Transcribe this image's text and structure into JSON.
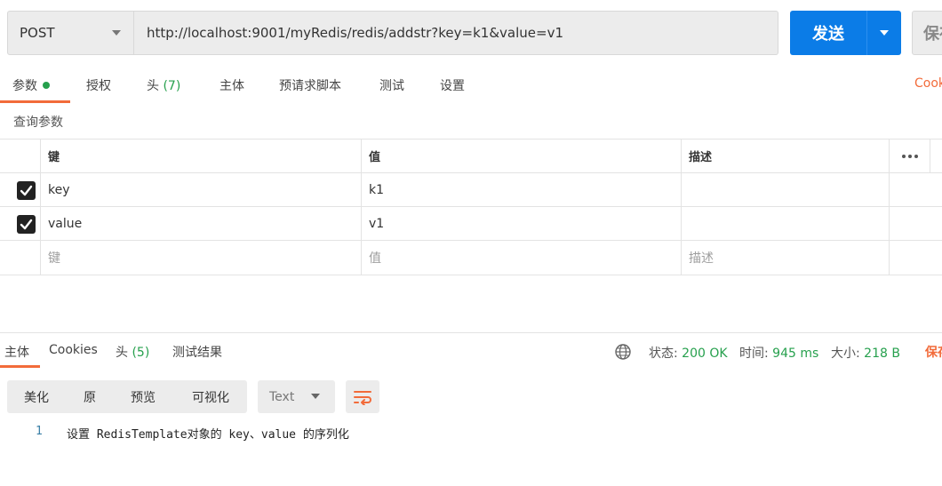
{
  "request": {
    "method": "POST",
    "url": "http://localhost:9001/myRedis/redis/addstr?key=k1&value=v1",
    "send_label": "发送",
    "save_label": "保存"
  },
  "request_tabs": [
    {
      "label": "参数"
    },
    {
      "label": "授权"
    },
    {
      "label": "头",
      "count": "(7)"
    },
    {
      "label": "主体"
    },
    {
      "label": "预请求脚本"
    },
    {
      "label": "测试"
    },
    {
      "label": "设置"
    }
  ],
  "cookies_link": "Cookies",
  "query_params": {
    "title": "查询参数",
    "headers": {
      "key": "键",
      "value": "值",
      "description": "描述"
    },
    "rows": [
      {
        "key": "key",
        "value": "k1",
        "description": ""
      },
      {
        "key": "value",
        "value": "v1",
        "description": ""
      }
    ],
    "placeholders": {
      "key": "键",
      "value": "值",
      "description": "描述"
    }
  },
  "response": {
    "tabs": [
      {
        "label": "主体"
      },
      {
        "label": "Cookies"
      },
      {
        "label": "头",
        "count": "(5)"
      },
      {
        "label": "测试结果"
      }
    ],
    "status_label": "状态:",
    "status_value": "200 OK",
    "time_label": "时间:",
    "time_value": "945 ms",
    "size_label": "大小:",
    "size_value": "218 B",
    "save_label": "保存",
    "view_modes": [
      "美化",
      "原",
      "预览",
      "可视化"
    ],
    "format": "Text",
    "body_lines": [
      {
        "no": "1",
        "text": "设置 RedisTemplate对象的 key、value 的序列化"
      }
    ]
  },
  "colors": {
    "accent": "#f26b3a",
    "primary": "#0b7ce7",
    "success": "#26a04d"
  }
}
